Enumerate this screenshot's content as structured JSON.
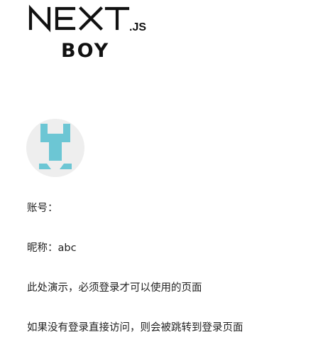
{
  "logo": {
    "word": "NEXT",
    "suffix": ".JS",
    "sub": "BOY"
  },
  "avatar": {
    "icon": "identicon-avatar",
    "color": "#6cc6d4"
  },
  "profile": {
    "account_label": "账号：",
    "account_value": "",
    "nickname_label": "昵称：",
    "nickname_value": "abc"
  },
  "notes": {
    "line1": "此处演示，必须登录才可以使用的页面",
    "line2": "如果没有登录直接访问，则会被跳转到登录页面"
  }
}
